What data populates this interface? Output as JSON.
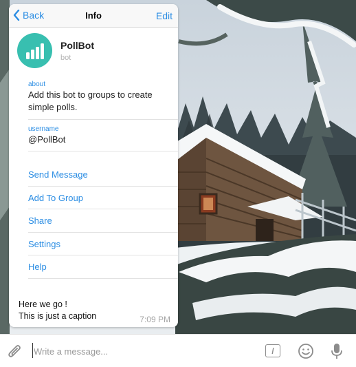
{
  "nav": {
    "back_label": "Back",
    "title": "Info",
    "edit_label": "Edit"
  },
  "profile": {
    "name": "PollBot",
    "subtitle": "bot",
    "avatar_icon": "bar-chart-icon",
    "avatar_color": "#38bfb0"
  },
  "about": {
    "label": "about",
    "value_line1": "Add this bot to groups to create",
    "value_line2": "simple polls."
  },
  "username": {
    "label": "username",
    "value": "@PollBot"
  },
  "actions": [
    "Send Message",
    "Add To Group",
    "Share",
    "Settings",
    "Help"
  ],
  "message": {
    "line1": "Here we go !",
    "line2": "This is just a caption",
    "time": "7:09 PM"
  },
  "composer": {
    "placeholder": "Write a message...",
    "command_symbol": "/"
  },
  "colors": {
    "accent": "#2b8de3"
  }
}
